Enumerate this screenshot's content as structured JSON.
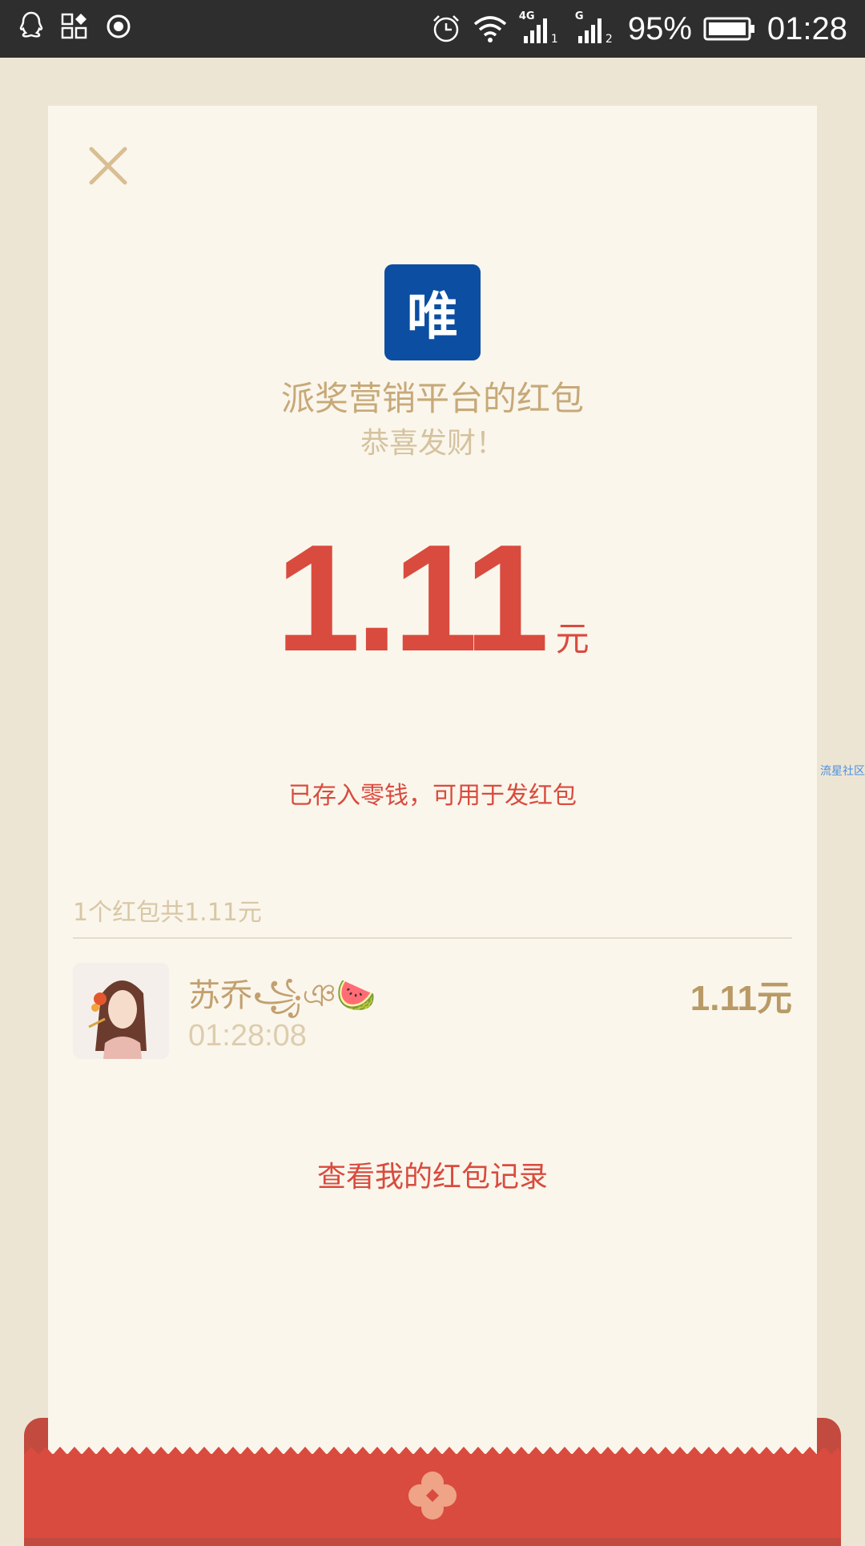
{
  "status_bar": {
    "battery": "95%",
    "time": "01:28",
    "network_sim1": "4G",
    "network_sim2": "G",
    "signal_sim1_index": "1",
    "signal_sim2_index": "2"
  },
  "card": {
    "logo_char": "唯",
    "sender_title": "派奖营销平台的红包",
    "greeting": "恭喜发财！",
    "amount": "1.11",
    "amount_unit": "元",
    "saved_note": "已存入零钱，可用于发红包",
    "summary": "1个红包共1.11元",
    "records_link": "查看我的红包记录",
    "watermark": "流星社区"
  },
  "receivers": [
    {
      "name": "苏乔꧁ঞ🍉",
      "time": "01:28:08",
      "amount": "1.11元"
    }
  ],
  "colors": {
    "accent_red": "#D94B3E",
    "gold": "#C7A978",
    "logo_blue": "#0B4EA2",
    "card_bg": "#FAF6EC",
    "page_bg": "#EDE5D4"
  },
  "icons": [
    "qq-icon",
    "apps-icon",
    "record-icon",
    "alarm-icon",
    "wifi-icon",
    "signal-icon",
    "battery-icon",
    "close-icon",
    "flower-icon"
  ]
}
